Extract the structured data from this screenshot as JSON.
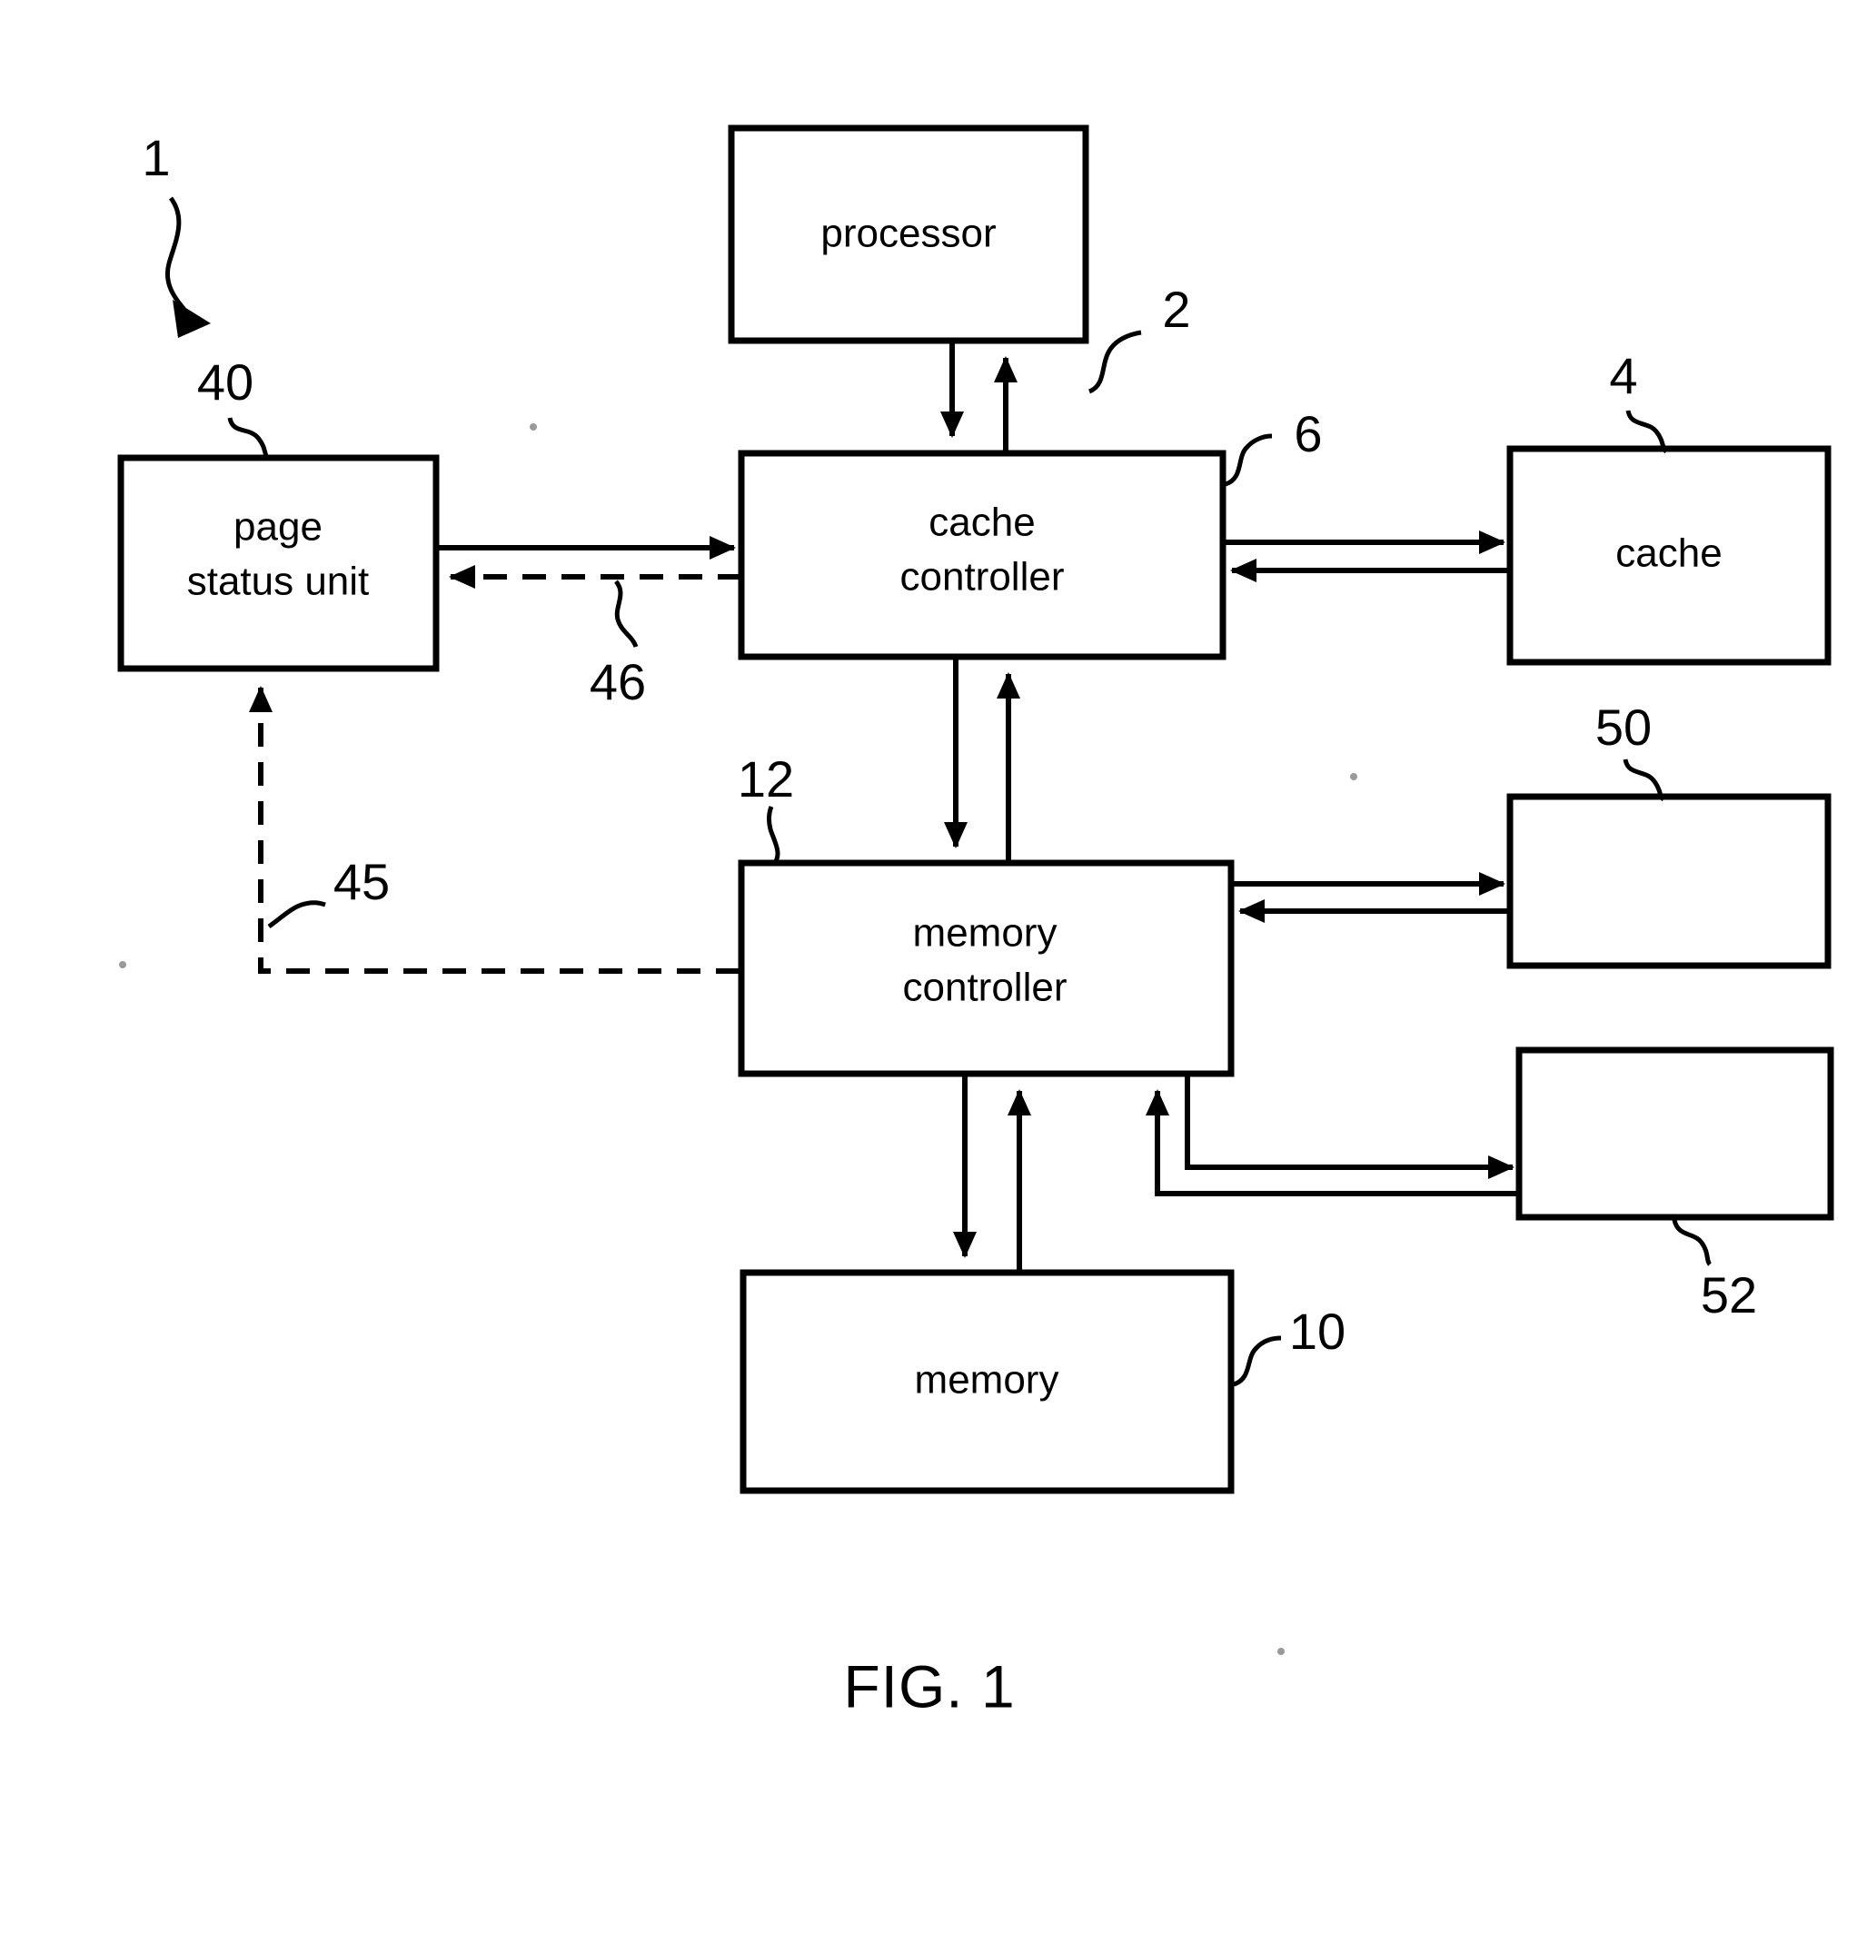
{
  "figure": {
    "caption": "FIG. 1",
    "system_ref": "1"
  },
  "blocks": [
    {
      "id": "processor",
      "label": "processor",
      "label_line1": "processor",
      "label_line2": "",
      "ref": "2"
    },
    {
      "id": "page-status-unit",
      "label": "page status unit",
      "label_line1": "page",
      "label_line2": "status unit",
      "ref": "40"
    },
    {
      "id": "cache-controller",
      "label": "cache controller",
      "label_line1": "cache",
      "label_line2": "controller",
      "ref": "6"
    },
    {
      "id": "cache",
      "label": "cache",
      "label_line1": "cache",
      "label_line2": "",
      "ref": "4"
    },
    {
      "id": "memory-controller",
      "label": "memory controller",
      "label_line1": "memory",
      "label_line2": "controller",
      "ref": "12"
    },
    {
      "id": "memory",
      "label": "memory",
      "label_line1": "memory",
      "label_line2": "",
      "ref": "10"
    },
    {
      "id": "unlabelled-block-50",
      "label": "",
      "label_line1": "",
      "label_line2": "",
      "ref": "50"
    },
    {
      "id": "unlabelled-block-52",
      "label": "",
      "label_line1": "",
      "label_line2": "",
      "ref": "52"
    }
  ],
  "connections": [
    {
      "id": "processor-to-cache-controller",
      "style": "solid",
      "ref": ""
    },
    {
      "id": "cache-controller-to-processor",
      "style": "solid",
      "ref": ""
    },
    {
      "id": "page-status-unit-to-cache-controller",
      "style": "solid",
      "ref": ""
    },
    {
      "id": "cache-controller-to-page-status-unit",
      "style": "dashed",
      "ref": "46"
    },
    {
      "id": "cache-controller-to-cache",
      "style": "solid",
      "ref": ""
    },
    {
      "id": "cache-to-cache-controller",
      "style": "solid",
      "ref": ""
    },
    {
      "id": "cache-controller-to-memory-controller",
      "style": "solid",
      "ref": ""
    },
    {
      "id": "memory-controller-to-cache-controller",
      "style": "solid",
      "ref": ""
    },
    {
      "id": "memory-controller-to-page-status-unit",
      "style": "dashed",
      "ref": "45"
    },
    {
      "id": "memory-controller-to-block-50",
      "style": "solid",
      "ref": ""
    },
    {
      "id": "block-50-to-memory-controller",
      "style": "solid",
      "ref": ""
    },
    {
      "id": "memory-controller-to-block-52",
      "style": "solid",
      "ref": ""
    },
    {
      "id": "block-52-to-memory-controller",
      "style": "solid",
      "ref": ""
    },
    {
      "id": "memory-controller-to-memory",
      "style": "solid",
      "ref": ""
    },
    {
      "id": "memory-to-memory-controller",
      "style": "solid",
      "ref": ""
    }
  ],
  "colors": {
    "ink": "#000000",
    "paper": "#ffffff"
  }
}
